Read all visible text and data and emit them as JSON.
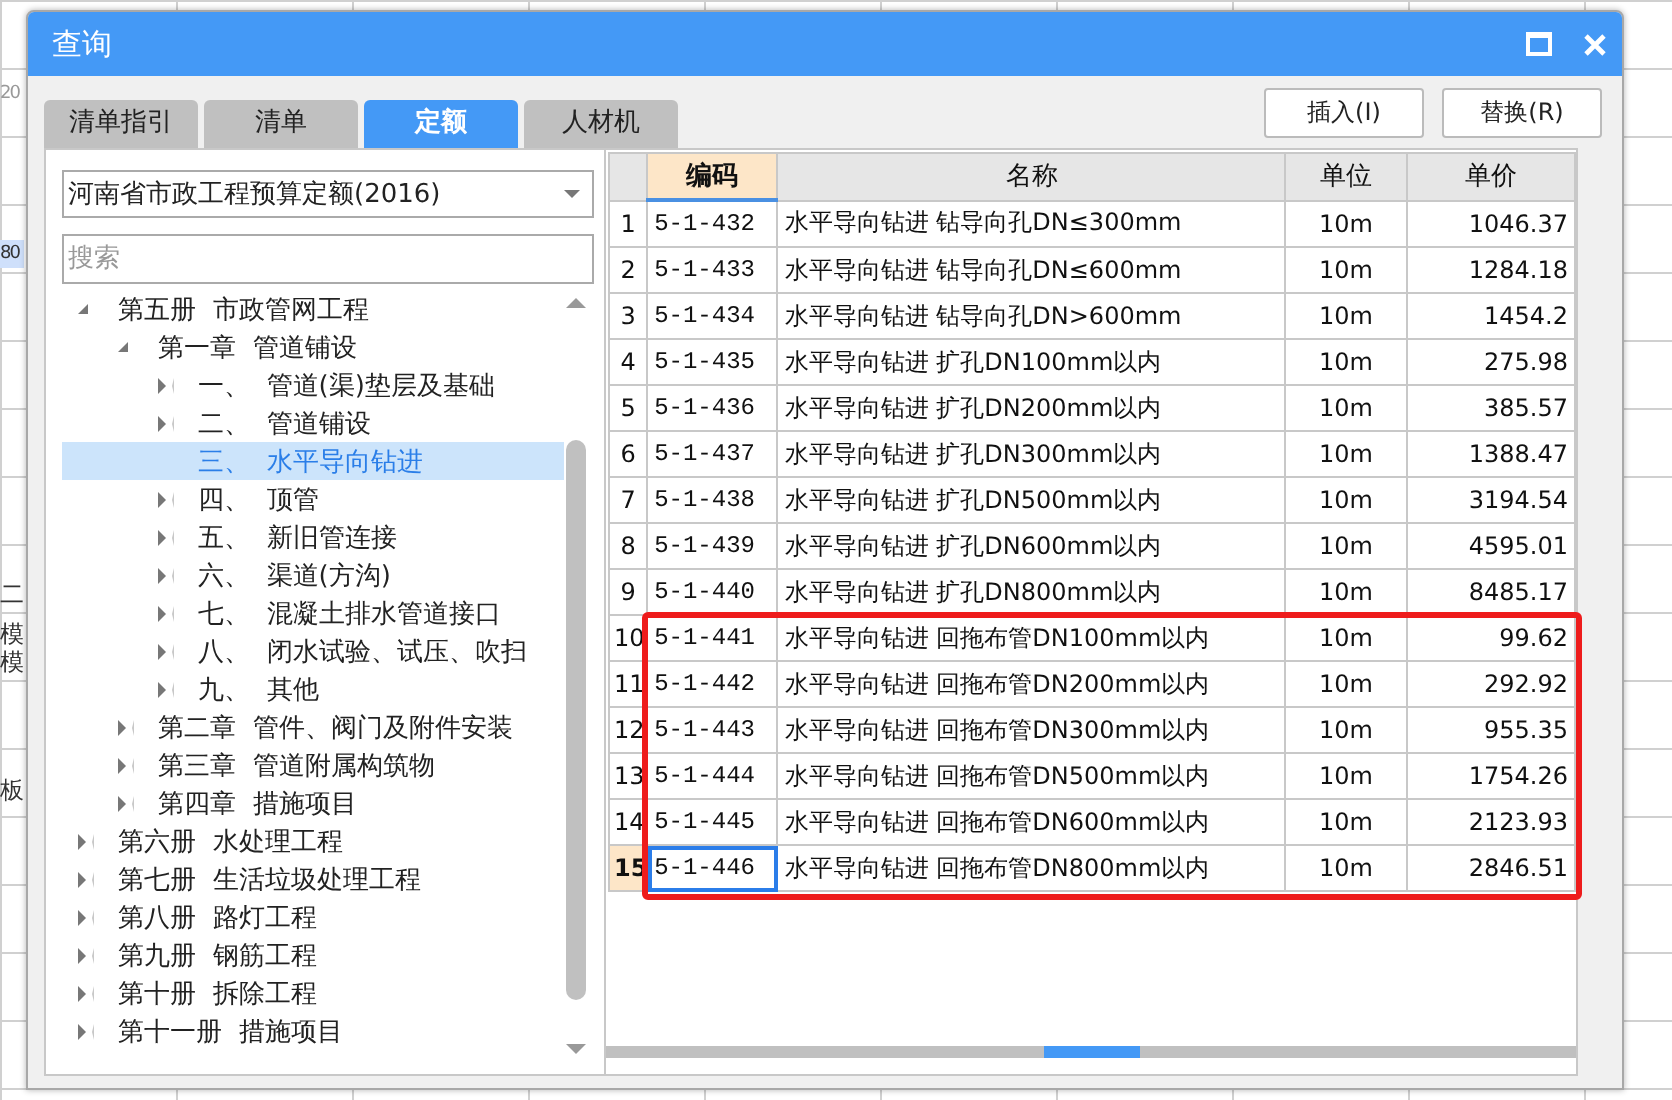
{
  "background_app": {
    "texts": [
      "20",
      "80",
      "二",
      "模",
      "模",
      "板"
    ]
  },
  "window": {
    "title": "查询"
  },
  "tabs": [
    {
      "label": "清单指引",
      "selected": false
    },
    {
      "label": "清单",
      "selected": false
    },
    {
      "label": "定额",
      "selected": true
    },
    {
      "label": "人材机",
      "selected": false
    }
  ],
  "buttons": [
    "插入(I)",
    "替换(R)"
  ],
  "library_select": {
    "value": "河南省市政工程预算定额(2016)"
  },
  "search": {
    "placeholder": "搜索"
  },
  "tree": [
    {
      "label": "第五册  市政管网工程",
      "expandable": true,
      "expanded": true,
      "selected": false,
      "children": [
        {
          "label": "第一章  管道铺设",
          "expandable": true,
          "expanded": true,
          "selected": false,
          "children": [
            {
              "label": "一、  管道(渠)垫层及基础",
              "expandable": true,
              "expanded": false,
              "selected": false
            },
            {
              "label": "二、  管道铺设",
              "expandable": true,
              "expanded": false,
              "selected": false
            },
            {
              "label": "三、  水平导向钻进",
              "expandable": false,
              "expanded": false,
              "selected": true
            },
            {
              "label": "四、  顶管",
              "expandable": true,
              "expanded": false,
              "selected": false
            },
            {
              "label": "五、  新旧管连接",
              "expandable": true,
              "expanded": false,
              "selected": false
            },
            {
              "label": "六、  渠道(方沟)",
              "expandable": true,
              "expanded": false,
              "selected": false
            },
            {
              "label": "七、  混凝土排水管道接口",
              "expandable": true,
              "expanded": false,
              "selected": false
            },
            {
              "label": "八、  闭水试验、试压、吹扫",
              "expandable": true,
              "expanded": false,
              "selected": false
            },
            {
              "label": "九、  其他",
              "expandable": true,
              "expanded": false,
              "selected": false
            }
          ]
        },
        {
          "label": "第二章  管件、阀门及附件安装",
          "expandable": true,
          "expanded": false,
          "selected": false
        },
        {
          "label": "第三章  管道附属构筑物",
          "expandable": true,
          "expanded": false,
          "selected": false
        },
        {
          "label": "第四章  措施项目",
          "expandable": true,
          "expanded": false,
          "selected": false
        }
      ]
    },
    {
      "label": "第六册  水处理工程",
      "expandable": true,
      "expanded": false,
      "selected": false
    },
    {
      "label": "第七册  生活垃圾处理工程",
      "expandable": true,
      "expanded": false,
      "selected": false
    },
    {
      "label": "第八册  路灯工程",
      "expandable": true,
      "expanded": false,
      "selected": false
    },
    {
      "label": "第九册  钢筋工程",
      "expandable": true,
      "expanded": false,
      "selected": false
    },
    {
      "label": "第十册  拆除工程",
      "expandable": true,
      "expanded": false,
      "selected": false
    },
    {
      "label": "第十一册  措施项目",
      "expandable": true,
      "expanded": false,
      "selected": false
    }
  ],
  "table": {
    "columns": [
      {
        "label": "编码",
        "selected": true
      },
      {
        "label": "名称",
        "selected": false
      },
      {
        "label": "单位",
        "selected": false
      },
      {
        "label": "单价",
        "selected": false
      }
    ],
    "rows": [
      {
        "number": "1",
        "code": "5-1-432",
        "name": "水平导向钻进  钻导向孔DN≤300mm",
        "unit": "10m",
        "price": "1046.37",
        "selected": false,
        "highlighted": false
      },
      {
        "number": "2",
        "code": "5-1-433",
        "name": "水平导向钻进  钻导向孔DN≤600mm",
        "unit": "10m",
        "price": "1284.18",
        "selected": false,
        "highlighted": false
      },
      {
        "number": "3",
        "code": "5-1-434",
        "name": "水平导向钻进  钻导向孔DN>600mm",
        "unit": "10m",
        "price": "1454.2",
        "selected": false,
        "highlighted": false
      },
      {
        "number": "4",
        "code": "5-1-435",
        "name": "水平导向钻进  扩孔DN100mm以内",
        "unit": "10m",
        "price": "275.98",
        "selected": false,
        "highlighted": false
      },
      {
        "number": "5",
        "code": "5-1-436",
        "name": "水平导向钻进  扩孔DN200mm以内",
        "unit": "10m",
        "price": "385.57",
        "selected": false,
        "highlighted": false
      },
      {
        "number": "6",
        "code": "5-1-437",
        "name": "水平导向钻进  扩孔DN300mm以内",
        "unit": "10m",
        "price": "1388.47",
        "selected": false,
        "highlighted": false
      },
      {
        "number": "7",
        "code": "5-1-438",
        "name": "水平导向钻进  扩孔DN500mm以内",
        "unit": "10m",
        "price": "3194.54",
        "selected": false,
        "highlighted": false
      },
      {
        "number": "8",
        "code": "5-1-439",
        "name": "水平导向钻进  扩孔DN600mm以内",
        "unit": "10m",
        "price": "4595.01",
        "selected": false,
        "highlighted": false
      },
      {
        "number": "9",
        "code": "5-1-440",
        "name": "水平导向钻进  扩孔DN800mm以内",
        "unit": "10m",
        "price": "8485.17",
        "selected": false,
        "highlighted": false
      },
      {
        "number": "10",
        "code": "5-1-441",
        "name": "水平导向钻进  回拖布管DN100mm以内",
        "unit": "10m",
        "price": "99.62",
        "selected": false,
        "highlighted": true
      },
      {
        "number": "11",
        "code": "5-1-442",
        "name": "水平导向钻进  回拖布管DN200mm以内",
        "unit": "10m",
        "price": "292.92",
        "selected": false,
        "highlighted": true
      },
      {
        "number": "12",
        "code": "5-1-443",
        "name": "水平导向钻进  回拖布管DN300mm以内",
        "unit": "10m",
        "price": "955.35",
        "selected": false,
        "highlighted": true
      },
      {
        "number": "13",
        "code": "5-1-444",
        "name": "水平导向钻进  回拖布管DN500mm以内",
        "unit": "10m",
        "price": "1754.26",
        "selected": false,
        "highlighted": true
      },
      {
        "number": "14",
        "code": "5-1-445",
        "name": "水平导向钻进  回拖布管DN600mm以内",
        "unit": "10m",
        "price": "2123.93",
        "selected": false,
        "highlighted": true
      },
      {
        "number": "15",
        "code": "5-1-446",
        "name": "水平导向钻进  回拖布管DN800mm以内",
        "unit": "10m",
        "price": "2846.51",
        "selected": true,
        "highlighted": true
      }
    ]
  }
}
